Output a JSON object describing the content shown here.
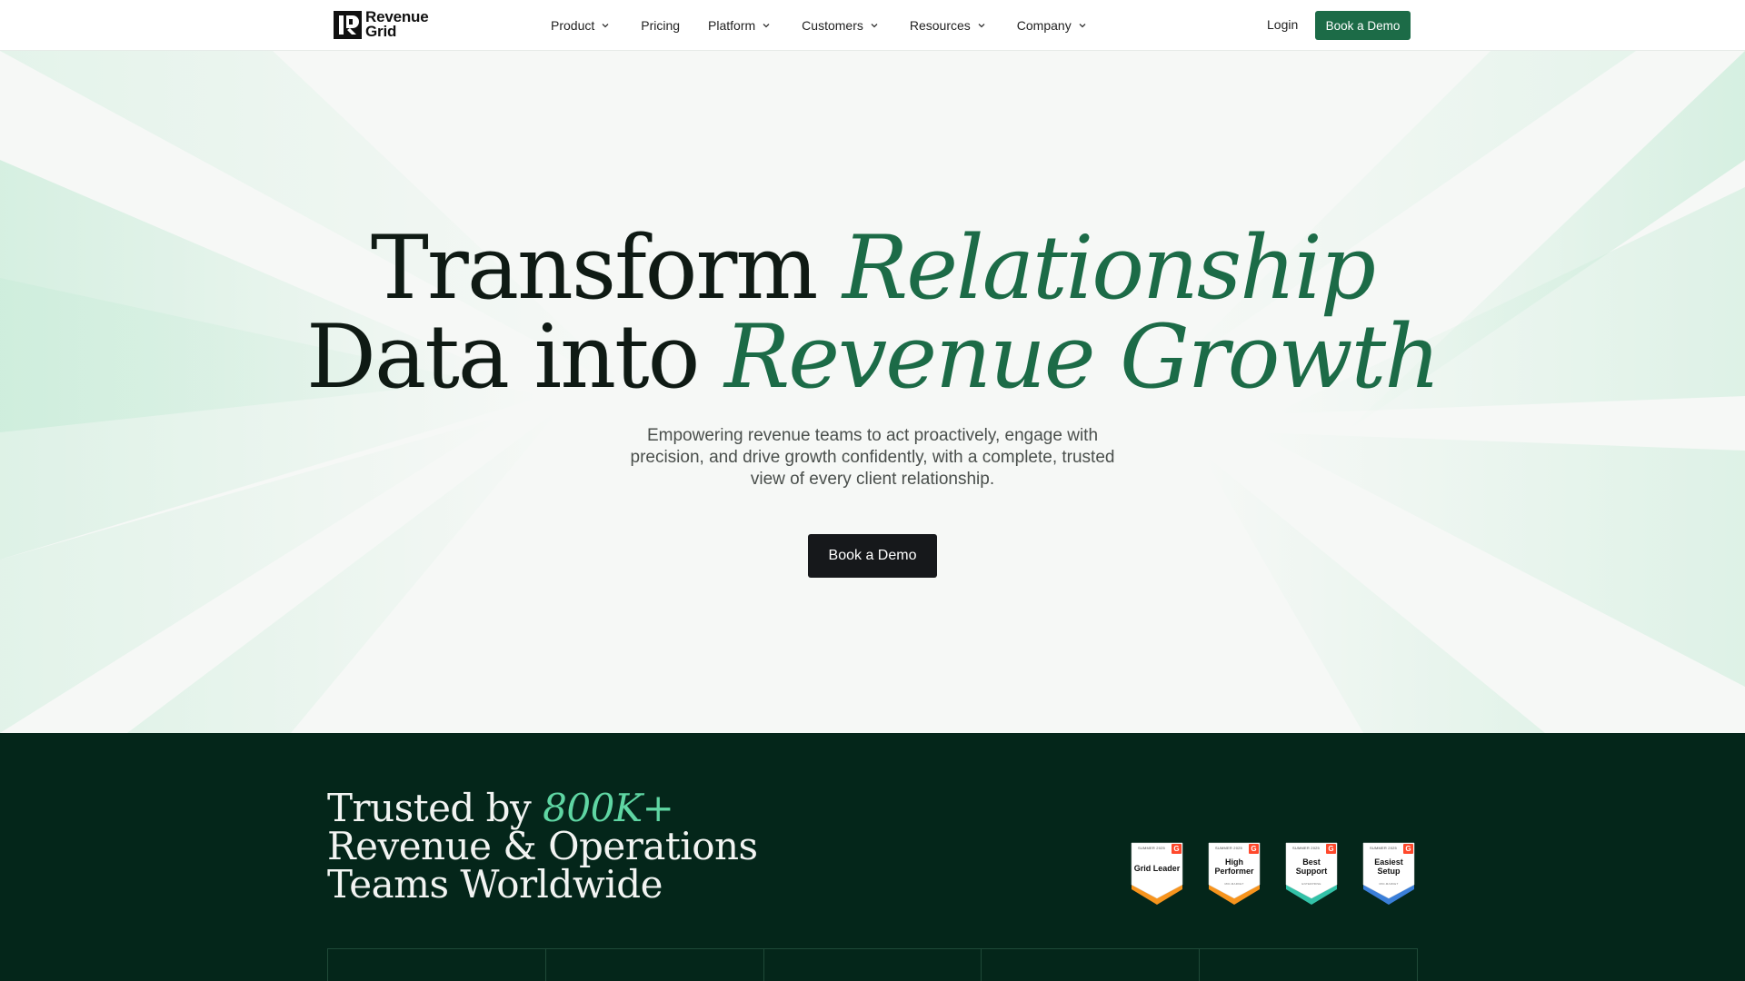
{
  "brand": {
    "line1": "Revenue",
    "line2": "Grid"
  },
  "nav": {
    "items": [
      {
        "label": "Product",
        "dropdown": true
      },
      {
        "label": "Pricing",
        "dropdown": false
      },
      {
        "label": "Platform",
        "dropdown": true
      },
      {
        "label": "Customers",
        "dropdown": true
      },
      {
        "label": "Resources",
        "dropdown": true
      },
      {
        "label": "Company",
        "dropdown": true
      }
    ],
    "login": "Login",
    "cta": "Book a Demo"
  },
  "hero": {
    "title_plain_1": "Transform ",
    "title_accent_1": "Relationship",
    "title_plain_2": "Data into ",
    "title_accent_2": "Revenue Growth",
    "subtitle": "Empowering revenue teams to act proactively, engage with precision, and drive growth confidently, with a complete, trusted view of every client relationship.",
    "cta": "Book a Demo"
  },
  "trust": {
    "title_prefix": "Trusted by ",
    "title_accent": "800K+",
    "title_line2": "Revenue & Operations",
    "title_line3": "Teams Worldwide",
    "badges": [
      {
        "season": "SUMMER 2025",
        "label": "Grid Leader",
        "sub": "",
        "stripe": "#f7941d"
      },
      {
        "season": "SUMMER 2025",
        "label": "High Performer",
        "sub": "MID-MARKET",
        "stripe": "#f7941d"
      },
      {
        "season": "SUMMER 2025",
        "label": "Best Support",
        "sub": "ENTERPRISE",
        "stripe": "#33c2a8"
      },
      {
        "season": "SUMMER 2025",
        "label": "Easiest Setup",
        "sub": "MID-MARKET",
        "stripe": "#3b7fd9"
      }
    ]
  },
  "colors": {
    "accent": "#1c6b47",
    "dark_section": "#04261a",
    "accent_light": "#5fd6a3",
    "hero_cta": "#16181b"
  }
}
